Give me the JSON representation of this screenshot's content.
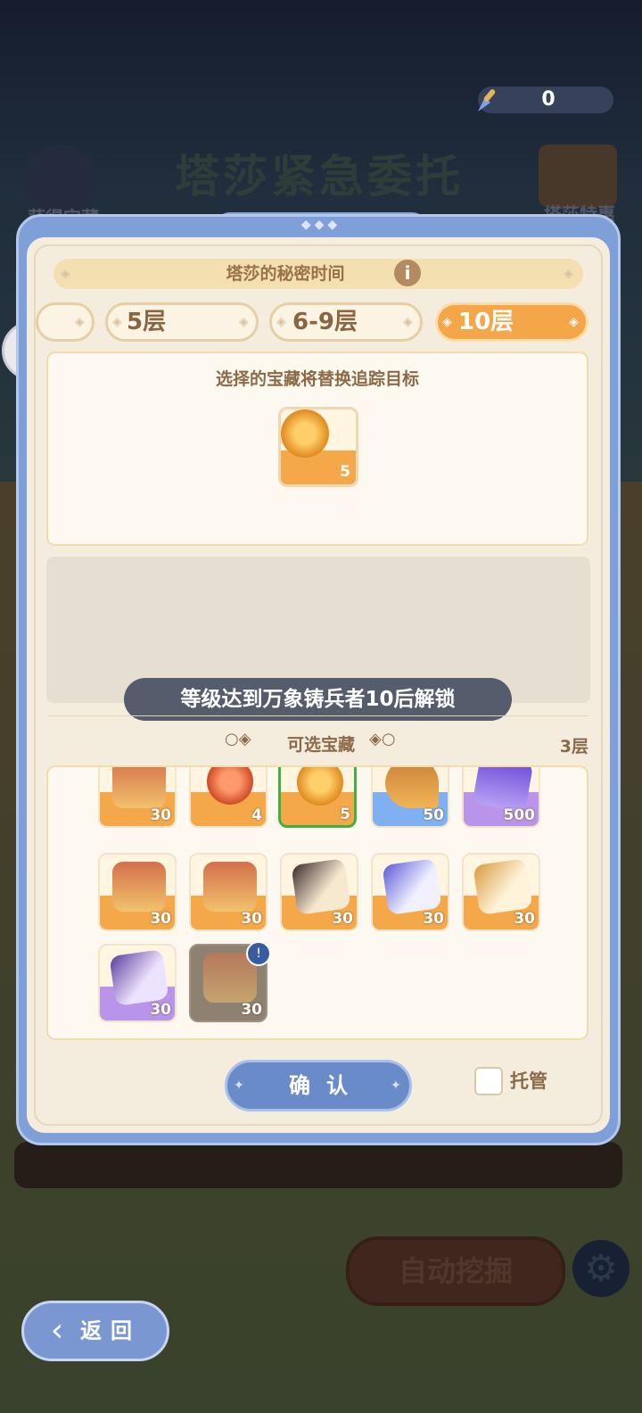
{
  "header": {
    "coin_value": "0"
  },
  "modal": {
    "time_label": "塔莎的秘密时间",
    "tiers": [
      {
        "label": ""
      },
      {
        "label": "5层"
      },
      {
        "label": "6-9层"
      },
      {
        "label": "10层"
      }
    ],
    "selected_tier": "10层",
    "target_text": "选择的宝藏将替换追踪目标",
    "target_item_count": "5",
    "lock_banner": "等级达到万象铸兵者10后解锁",
    "section_title": "可选宝藏",
    "floor_info": "3层",
    "items": [
      {
        "count": "30",
        "icon": "chest-icon",
        "rarity": "orange"
      },
      {
        "count": "4",
        "icon": "orb-icon",
        "rarity": "orange"
      },
      {
        "count": "5",
        "icon": "coin-icon",
        "rarity": "orange",
        "selected": true
      },
      {
        "count": "50",
        "icon": "horn-icon",
        "rarity": "blue"
      },
      {
        "count": "500",
        "icon": "gem-icon",
        "rarity": "purple"
      },
      {
        "count": "30",
        "icon": "chest-icon",
        "rarity": "orange"
      },
      {
        "count": "30",
        "icon": "chest-icon",
        "rarity": "orange"
      },
      {
        "count": "30",
        "icon": "ticket-icon",
        "rarity": "orange"
      },
      {
        "count": "30",
        "icon": "ticket-blue-icon",
        "rarity": "orange"
      },
      {
        "count": "30",
        "icon": "ticket-gold-icon",
        "rarity": "orange"
      },
      {
        "count": "30",
        "icon": "ticket-purple-icon",
        "rarity": "purple"
      },
      {
        "count": "30",
        "icon": "chest-icon",
        "rarity": "locked"
      }
    ],
    "confirm_label": "确认",
    "auto_label": "托管"
  },
  "background": {
    "title": "塔莎紧急委托",
    "left_label": "获得宝藏",
    "right_label": "塔莎特惠",
    "auto_dig_label": "自动挖掘"
  },
  "footer": {
    "back_label": "返回"
  },
  "colors": {
    "accent": "#f4a648",
    "modal_frame": "#7f9fd8",
    "panel": "#f4ecdd"
  }
}
